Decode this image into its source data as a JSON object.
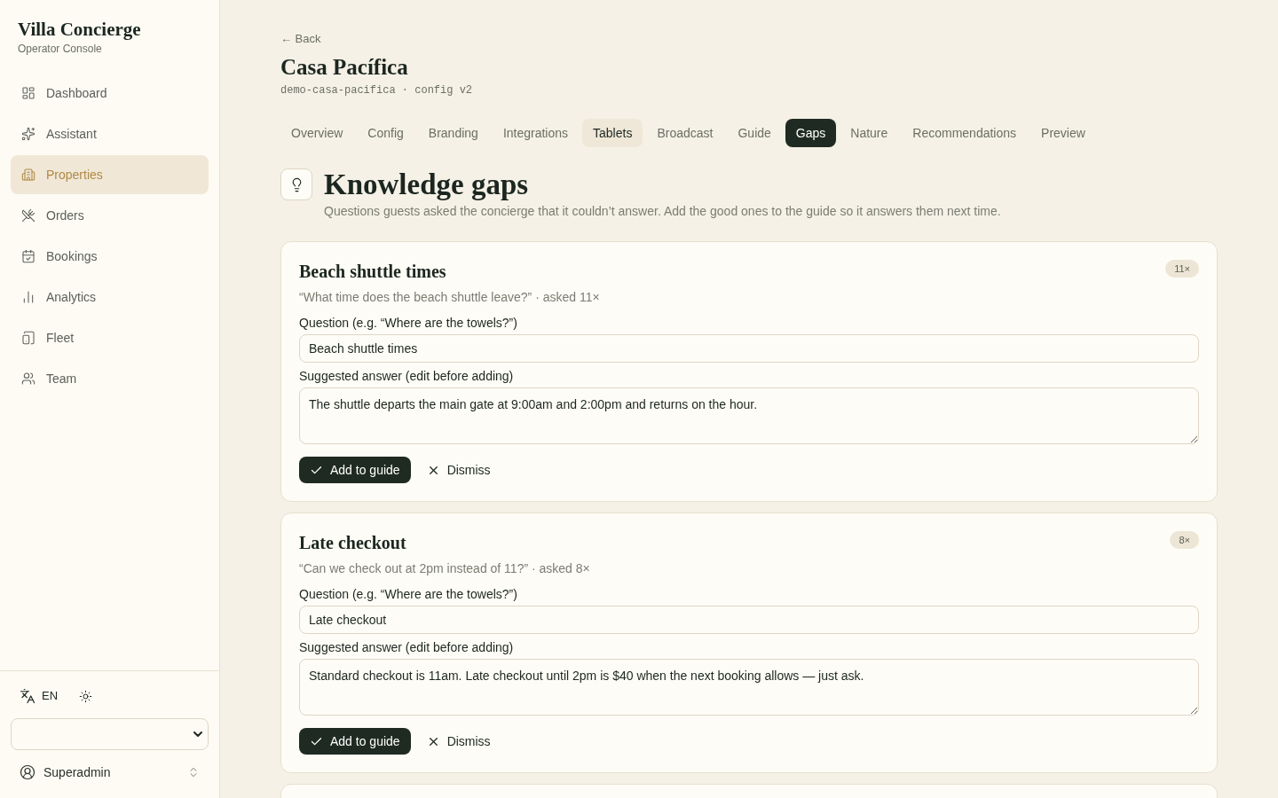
{
  "sidebar": {
    "brand": {
      "title": "Villa Concierge",
      "subtitle": "Operator Console"
    },
    "nav": [
      {
        "label": "Dashboard",
        "selected": false
      },
      {
        "label": "Assistant",
        "selected": false
      },
      {
        "label": "Properties",
        "selected": true
      },
      {
        "label": "Orders",
        "selected": false
      },
      {
        "label": "Bookings",
        "selected": false
      },
      {
        "label": "Analytics",
        "selected": false
      },
      {
        "label": "Fleet",
        "selected": false
      },
      {
        "label": "Team",
        "selected": false
      }
    ],
    "language": "EN",
    "user": "Superadmin"
  },
  "header": {
    "back": "← Back",
    "title": "Casa Pacífica",
    "meta": "demo-casa-pacifica · config v2"
  },
  "tabs": [
    {
      "label": "Overview",
      "selected": false,
      "highlighted": false
    },
    {
      "label": "Config",
      "selected": false,
      "highlighted": false
    },
    {
      "label": "Branding",
      "selected": false,
      "highlighted": false
    },
    {
      "label": "Integrations",
      "selected": false,
      "highlighted": false
    },
    {
      "label": "Tablets",
      "selected": false,
      "highlighted": true
    },
    {
      "label": "Broadcast",
      "selected": false,
      "highlighted": false
    },
    {
      "label": "Guide",
      "selected": false,
      "highlighted": false
    },
    {
      "label": "Gaps",
      "selected": true,
      "highlighted": false
    },
    {
      "label": "Nature",
      "selected": false,
      "highlighted": false
    },
    {
      "label": "Recommendations",
      "selected": false,
      "highlighted": false
    },
    {
      "label": "Preview",
      "selected": false,
      "highlighted": false
    }
  ],
  "section": {
    "title": "Knowledge gaps",
    "description": "Questions guests asked the concierge that it couldn’t answer. Add the good ones to the guide so it answers them next time."
  },
  "gaps": [
    {
      "title": "Beach shuttle times",
      "count": "11×",
      "summary": "“What time does the beach shuttle leave?” · asked 11×",
      "question_label": "Question (e.g. “Where are the towels?”)",
      "question": "Beach shuttle times",
      "answer_label": "Suggested answer (edit before adding)",
      "answer": "The shuttle departs the main gate at 9:00am and 2:00pm and returns on the hour.",
      "add_button": "Add to guide",
      "dismiss_button": "Dismiss"
    },
    {
      "title": "Late checkout",
      "count": "8×",
      "summary": "“Can we check out at 2pm instead of 11?” · asked 8×",
      "question_label": "Question (e.g. “Where are the towels?”)",
      "question": "Late checkout",
      "answer_label": "Suggested answer (edit before adding)",
      "answer": "Standard checkout is 11am. Late checkout until 2pm is $40 when the next booking allows — just ask.",
      "add_button": "Add to guide",
      "dismiss_button": "Dismiss"
    }
  ]
}
